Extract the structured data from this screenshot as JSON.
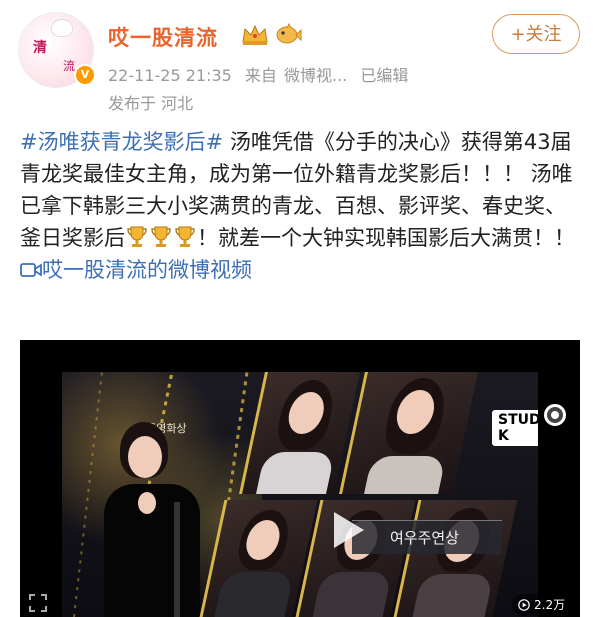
{
  "user": {
    "name": "哎一股清流",
    "avatar_text_top": "清",
    "avatar_text_bottom": "流",
    "verified_badge": "V"
  },
  "follow_button": {
    "label": "+关注"
  },
  "meta": {
    "time": "22-11-25 21:35",
    "source_prefix": "来自",
    "source": "微博视...",
    "edited": "已编辑",
    "location": "发布于 河北"
  },
  "post": {
    "topic": "#汤唯获青龙奖影后#",
    "body1": "汤唯凭借《分手的决心》获得第43届青龙奖最佳女主角，成为第一位外籍青龙奖影后！！！ 汤唯已拿下韩影三大小奖满贯的青龙、百想、影评奖、春史奖、釜日奖影后",
    "body2": "！就差一个大钟实现韩国影后大满贯！！",
    "video_link": "哎一股清流的微博视频"
  },
  "video": {
    "banner_text": "여우주연상",
    "studio_tag": "STUDIO K",
    "broadcast_logo": "청룡영화상",
    "views": "2.2万"
  },
  "icons": {
    "crown": "crown-icon",
    "fish": "fish-icon",
    "trophy": "trophy-icon",
    "video_link": "video-icon",
    "play": "play-icon",
    "views": "play-count-icon",
    "record": "record-icon"
  },
  "colors": {
    "username": "#e8662e",
    "link": "#3d6fb5",
    "follow_border": "#d79b5e",
    "meta": "#999999"
  }
}
